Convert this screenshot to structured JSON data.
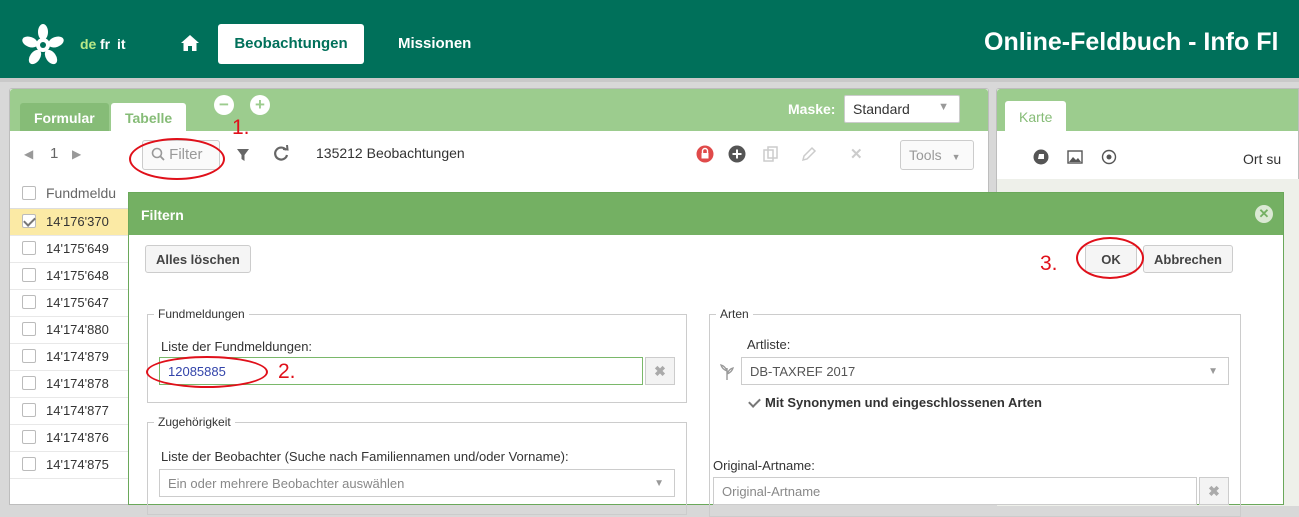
{
  "header": {
    "languages": [
      "de",
      "fr",
      "it"
    ],
    "active_language": "de",
    "nav": {
      "active": "Beobachtungen",
      "other": "Missionen"
    },
    "app_title": "Online-Feldbuch  -  Info Fl"
  },
  "left_panel": {
    "tabs": [
      "Formular",
      "Tabelle"
    ],
    "active_tab": "Tabelle",
    "maske_label": "Maske:",
    "maske_value": "Standard",
    "pager_page": "1",
    "filter_label": "Filter",
    "observation_count": "135212 Beobachtungen",
    "tools_label": "Tools",
    "column_header": "Fundmeldu",
    "rows": [
      "14'176'370",
      "14'175'649",
      "14'175'648",
      "14'175'647",
      "14'174'880",
      "14'174'879",
      "14'174'878",
      "14'174'877",
      "14'174'876",
      "14'174'875"
    ],
    "selected_row": 0
  },
  "right_panel": {
    "tab": "Karte",
    "search_partial": "Ort su"
  },
  "dialog": {
    "title": "Filtern",
    "clear_all": "Alles löschen",
    "ok": "OK",
    "cancel": "Abbrechen",
    "group_fundmeldungen": {
      "legend": "Fundmeldungen",
      "label": "Liste der Fundmeldungen:",
      "value": "12085885"
    },
    "group_zugehoerigkeit": {
      "legend": "Zugehörigkeit",
      "label": "Liste der Beobachter (Suche nach Familiennamen und/oder Vorname):",
      "placeholder": "Ein oder mehrere Beobachter auswählen"
    },
    "group_arten": {
      "legend": "Arten",
      "artliste_label": "Artliste:",
      "artliste_value": "DB-TAXREF 2017",
      "synonyms_label": "Mit Synonymen und eingeschlossenen Arten",
      "original_label": "Original-Artname:",
      "original_placeholder": "Original-Artname"
    }
  },
  "annotations": {
    "step1": "1.",
    "step2": "2.",
    "step3": "3."
  },
  "colors": {
    "brand_green": "#00705a",
    "tab_green": "#9ccc8e",
    "dialog_green": "#74b063",
    "annotation_red": "#e0101a"
  }
}
